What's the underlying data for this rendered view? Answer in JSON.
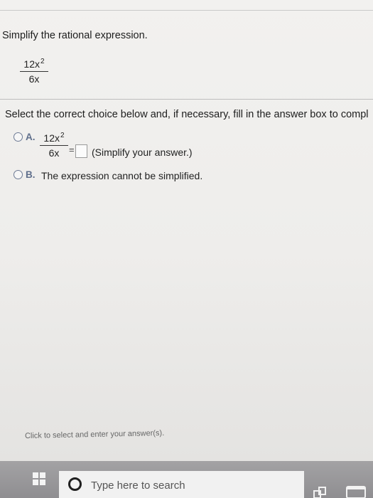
{
  "question": {
    "instruction": "Simplify the rational expression.",
    "numerator_base": "12x",
    "exponent": "2",
    "denominator": "6x"
  },
  "prompt": {
    "text": "Select the correct choice below and, if necessary, fill in the answer box to compl"
  },
  "choice_a": {
    "label": "A.",
    "numerator_base": "12x",
    "exponent": "2",
    "denominator": "6x",
    "equals": "=",
    "answer_value": "",
    "note": "(Simplify your answer.)"
  },
  "choice_b": {
    "label": "B.",
    "text": "The expression cannot be simplified."
  },
  "footer": {
    "hint": "Click to select and enter your answer(s)."
  },
  "taskbar": {
    "search_placeholder": "Type here to search"
  },
  "colors": {
    "option_label": "#5f6f8c",
    "taskbar": "#9a999c",
    "search_box": "#f1f1f1"
  },
  "icons": {
    "start": "windows-logo-icon",
    "search": "search-ring-icon",
    "task_view": "task-view-icon",
    "app": "app-window-icon"
  }
}
